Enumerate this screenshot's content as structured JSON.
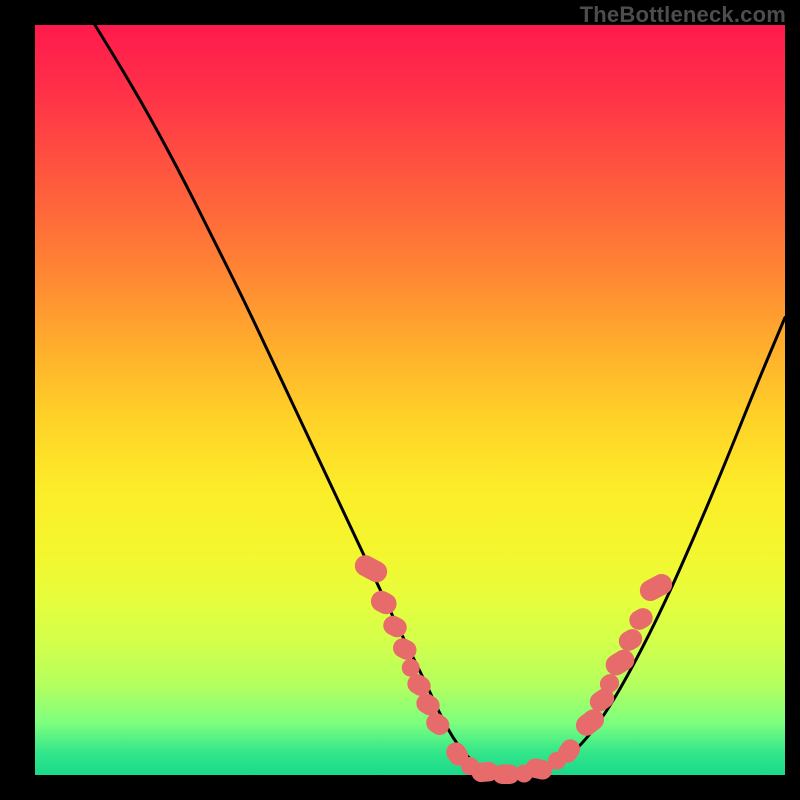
{
  "watermark": "TheBottleneck.com",
  "chart_data": {
    "type": "line",
    "title": "",
    "xlabel": "",
    "ylabel": "",
    "xlim": [
      0,
      100
    ],
    "ylim": [
      0,
      100
    ],
    "grid": false,
    "series": [
      {
        "name": "curve",
        "color": "#000000",
        "x": [
          8,
          12,
          16,
          20,
          24,
          28,
          32,
          36,
          40,
          44,
          48,
          52,
          54.5,
          57,
          60,
          64,
          68,
          72,
          76,
          80,
          84,
          88,
          92,
          96,
          100
        ],
        "y": [
          100,
          93.5,
          86.5,
          79,
          71,
          63,
          54.5,
          46,
          37.5,
          29,
          20.5,
          12.5,
          7,
          3,
          0.5,
          0,
          0.5,
          3,
          8,
          15,
          23,
          32,
          41.5,
          51.5,
          61
        ]
      }
    ],
    "markers": [
      {
        "name": "left-cluster",
        "color": "#e86b6b",
        "shape": "rounded",
        "points": [
          {
            "x": 44.8,
            "y": 27.5,
            "w": 2.8,
            "h": 4.5,
            "rot": -62
          },
          {
            "x": 46.5,
            "y": 23.0,
            "w": 2.8,
            "h": 3.5,
            "rot": -62
          },
          {
            "x": 48.0,
            "y": 19.8,
            "w": 2.6,
            "h": 3.2,
            "rot": -62
          },
          {
            "x": 49.3,
            "y": 16.8,
            "w": 2.6,
            "h": 3.2,
            "rot": -62
          },
          {
            "x": 50.1,
            "y": 14.3,
            "w": 2.4,
            "h": 2.4,
            "rot": -60
          },
          {
            "x": 51.2,
            "y": 12.0,
            "w": 2.6,
            "h": 3.2,
            "rot": -58
          },
          {
            "x": 52.4,
            "y": 9.4,
            "w": 2.6,
            "h": 3.2,
            "rot": -58
          },
          {
            "x": 53.7,
            "y": 6.8,
            "w": 2.6,
            "h": 3.2,
            "rot": -55
          }
        ]
      },
      {
        "name": "bottom-cluster",
        "color": "#e86b6b",
        "shape": "rounded",
        "points": [
          {
            "x": 56.3,
            "y": 2.8,
            "w": 2.6,
            "h": 3.2,
            "rot": -35
          },
          {
            "x": 58.0,
            "y": 1.2,
            "w": 2.4,
            "h": 2.4,
            "rot": -20
          },
          {
            "x": 60.0,
            "y": 0.4,
            "w": 3.6,
            "h": 2.6,
            "rot": -5
          },
          {
            "x": 62.8,
            "y": 0.1,
            "w": 3.6,
            "h": 2.6,
            "rot": 0
          },
          {
            "x": 65.2,
            "y": 0.2,
            "w": 2.4,
            "h": 2.4,
            "rot": 5
          },
          {
            "x": 67.2,
            "y": 0.8,
            "w": 3.6,
            "h": 2.6,
            "rot": 12
          },
          {
            "x": 69.6,
            "y": 1.9,
            "w": 2.4,
            "h": 2.4,
            "rot": 20
          },
          {
            "x": 71.2,
            "y": 3.2,
            "w": 2.6,
            "h": 3.2,
            "rot": 35
          }
        ]
      },
      {
        "name": "right-cluster",
        "color": "#e86b6b",
        "shape": "rounded",
        "points": [
          {
            "x": 74.0,
            "y": 7.0,
            "w": 2.8,
            "h": 4.0,
            "rot": 52
          },
          {
            "x": 75.6,
            "y": 10.0,
            "w": 2.6,
            "h": 3.4,
            "rot": 55
          },
          {
            "x": 76.6,
            "y": 12.2,
            "w": 2.4,
            "h": 2.6,
            "rot": 56
          },
          {
            "x": 78.0,
            "y": 15.0,
            "w": 2.8,
            "h": 4.0,
            "rot": 58
          },
          {
            "x": 79.4,
            "y": 18.0,
            "w": 2.6,
            "h": 3.2,
            "rot": 60
          },
          {
            "x": 80.8,
            "y": 20.8,
            "w": 2.6,
            "h": 3.2,
            "rot": 60
          },
          {
            "x": 82.8,
            "y": 25.0,
            "w": 2.8,
            "h": 4.5,
            "rot": 62
          }
        ]
      }
    ]
  }
}
